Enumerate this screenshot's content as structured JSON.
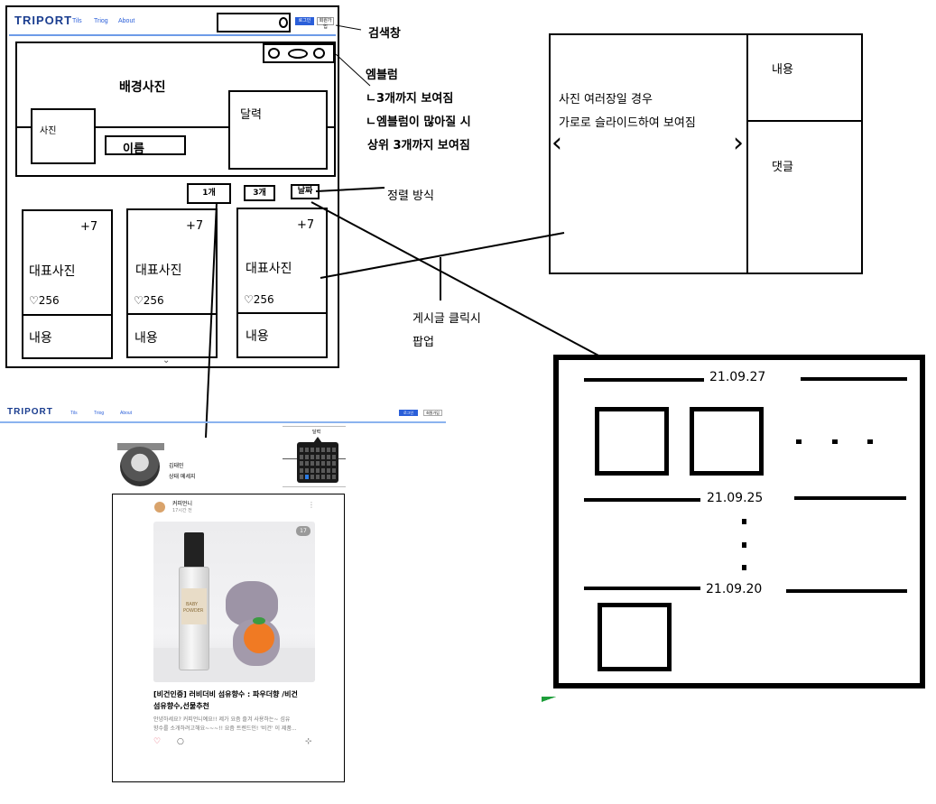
{
  "wire": {
    "logo": "TRIPORT",
    "nav": [
      "Tils",
      "Triog",
      "About"
    ],
    "btn1": "로그인",
    "btn2": "회원가입",
    "bg_label": "배경사진",
    "photo_label": "사진",
    "name_label": "이름",
    "calendar_label": "달력",
    "sort_buttons": [
      "1개",
      "3개",
      "날짜"
    ],
    "cards": [
      {
        "count": "+7",
        "title": "대표사진",
        "likes": "♡256",
        "content": "내용"
      },
      {
        "count": "+7",
        "title": "대표사진",
        "likes": "♡256",
        "content": "내용"
      },
      {
        "count": "+7",
        "title": "대표사진",
        "likes": "♡256",
        "content": "내용"
      }
    ],
    "chevron": "⌄"
  },
  "notes": {
    "search": "검색창",
    "emblem_title": "엠블럼",
    "emblem_1": "ㄴ3개까지 보여짐",
    "emblem_2": "ㄴ엠블럼이 많아질 시",
    "emblem_3": "상위 3개까지 보여짐",
    "sort": "정렬 방식",
    "popup_1": "게시글 클릭시",
    "popup_2": "팝업"
  },
  "popup": {
    "text1": "사진 여러장일 경우",
    "text2": "가로로 슬라이드하여 보여짐",
    "left": "‹",
    "right": "›",
    "content": "내용",
    "comment": "댓글"
  },
  "timeline": {
    "dates": [
      "21.09.27",
      "21.09.25",
      "21.09.20"
    ]
  },
  "mock": {
    "logo": "TRIPORT",
    "nav": [
      "Tils",
      "Triog",
      "About"
    ],
    "btn1": "로그인",
    "btn2": "회원가입",
    "user_name": "김태민",
    "status": "상태 메세지",
    "calendar": "달력",
    "author": "커피언니",
    "time": "17시간 전",
    "photo_count": "17",
    "bottle_label_1": "BABY",
    "bottle_label_2": "POWDER",
    "post_title_1": "[비건인증] 러비더비 섬유향수 : 파우더향 /비건",
    "post_title_2": "섬유향수,선물추천",
    "post_body_1": "안녕하세요? 커피언니예요!! 제가 요즘 즐겨 사용하는~ 섬유",
    "post_body_2": "향수를 소개하려고해요~~~!! 요즘 트렌드인! '비건' 이 제품...",
    "menu": "⋮"
  }
}
